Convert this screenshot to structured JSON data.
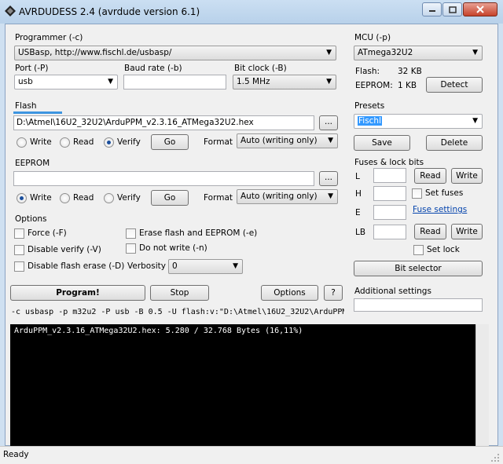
{
  "window": {
    "title": "AVRDUDESS 2.4 (avrdude version 6.1)"
  },
  "programmer": {
    "label": "Programmer (-c)",
    "value": "USBasp, http://www.fischl.de/usbasp/",
    "port_label": "Port (-P)",
    "port_value": "usb",
    "baud_label": "Baud rate (-b)",
    "baud_value": "",
    "bitclock_label": "Bit clock (-B)",
    "bitclock_value": "1.5 MHz"
  },
  "mcu": {
    "label": "MCU (-p)",
    "value": "ATmega32U2",
    "flash_label": "Flash:",
    "flash_value": "32 KB",
    "eeprom_label": "EEPROM:",
    "eeprom_value": "1 KB",
    "detect_label": "Detect"
  },
  "flash": {
    "label": "Flash",
    "path": "D:\\Atmel\\16U2_32U2\\ArduPPM_v2.3.16_ATMega32U2.hex",
    "browse": "...",
    "write": "Write",
    "read": "Read",
    "verify": "Verify",
    "go": "Go",
    "format_label": "Format",
    "format_value": "Auto (writing only)"
  },
  "eeprom": {
    "label": "EEPROM",
    "path": "",
    "browse": "...",
    "write": "Write",
    "read": "Read",
    "verify": "Verify",
    "go": "Go",
    "format_label": "Format",
    "format_value": "Auto (writing only)"
  },
  "presets": {
    "label": "Presets",
    "value": "Fischl",
    "save": "Save",
    "delete": "Delete"
  },
  "fuses": {
    "label": "Fuses & lock bits",
    "l_label": "L",
    "h_label": "H",
    "e_label": "E",
    "lb_label": "LB",
    "read": "Read",
    "write": "Write",
    "set_fuses": "Set fuses",
    "fuse_settings": "Fuse settings",
    "set_lock": "Set lock",
    "bit_selector": "Bit selector"
  },
  "options": {
    "label": "Options",
    "force": "Force (-F)",
    "disable_verify": "Disable verify (-V)",
    "disable_flash_erase": "Disable flash erase (-D)",
    "erase": "Erase flash and EEPROM (-e)",
    "no_write": "Do not write (-n)",
    "verbosity_label": "Verbosity",
    "verbosity_value": "0"
  },
  "actions": {
    "program": "Program!",
    "stop": "Stop",
    "options": "Options",
    "help": "?"
  },
  "additional": {
    "label": "Additional settings",
    "value": ""
  },
  "cmdline": "-c usbasp -p m32u2 -P usb -B 0.5 -U flash:v:\"D:\\Atmel\\16U2_32U2\\ArduPPM",
  "console": "ArduPPM_v2.3.16_ATMega32U2.hex: 5.280 / 32.768 Bytes (16,11%)",
  "status": "Ready",
  "colors": {
    "accent": "#3d95e0",
    "console_bg": "#000000",
    "link": "#0645ad",
    "selection": "#3399ff"
  }
}
